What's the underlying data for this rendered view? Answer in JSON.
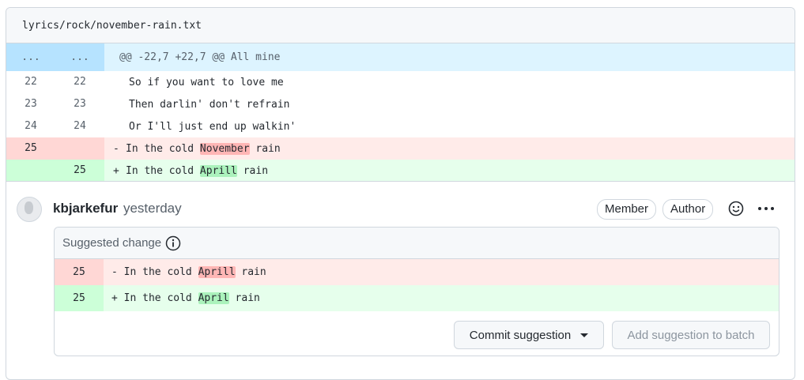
{
  "file": {
    "path": "lyrics/rock/november-rain.txt"
  },
  "diff": {
    "hunk": {
      "left": "...",
      "right": "...",
      "text": "@@ -22,7 +22,7 @@ All mine"
    },
    "context": [
      {
        "left": "22",
        "right": "22",
        "text": "So if you want to love me"
      },
      {
        "left": "23",
        "right": "23",
        "text": "Then darlin' don't refrain"
      },
      {
        "left": "24",
        "right": "24",
        "text": "Or I'll just end up walkin'"
      }
    ],
    "deleted": {
      "left": "25",
      "sign": "-",
      "before": "In the cold ",
      "highlight": "November",
      "after": " rain"
    },
    "added": {
      "right": "25",
      "sign": "+",
      "before": "In the cold ",
      "highlight": "Aprill",
      "after": " rain"
    }
  },
  "comment": {
    "author": "kbjarkefur",
    "time": "yesterday",
    "badges": [
      "Member",
      "Author"
    ],
    "emoji_icon": "smiley-icon",
    "menu_icon": "kebab-horizontal-icon",
    "suggestion": {
      "title": "Suggested change",
      "info_icon": "info-icon",
      "deleted": {
        "num": "25",
        "sign": "-",
        "before": "In the cold ",
        "highlight": "Aprill",
        "after": " rain"
      },
      "added": {
        "num": "25",
        "sign": "+",
        "before": "In the cold ",
        "highlight": "April",
        "after": " rain"
      },
      "commit_label": "Commit suggestion",
      "batch_label": "Add suggestion to batch"
    }
  },
  "colors": {
    "hunk_bg": "#ddf4ff",
    "del_bg": "#ffebe9",
    "add_bg": "#e6ffec",
    "del_highlight": "#ff8182",
    "add_highlight": "#abf2bc"
  }
}
